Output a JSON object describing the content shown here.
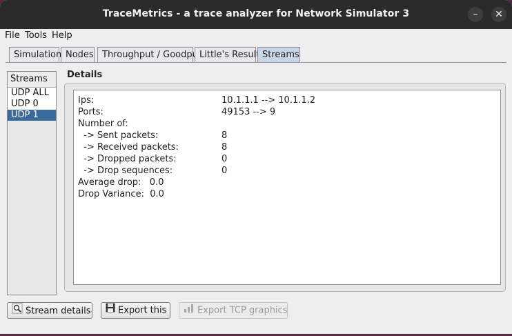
{
  "window": {
    "title": "TraceMetrics - a trace analyzer for Network Simulator 3"
  },
  "menu": [
    "File",
    "Tools",
    "Help"
  ],
  "tabs": [
    "Simulation",
    "Nodes",
    "Throughput / Goodput",
    "Little's Result",
    "Streams"
  ],
  "active_tab": "Streams",
  "streams": {
    "header": "Streams",
    "items": [
      "UDP ALL",
      "UDP 0",
      "UDP 1"
    ],
    "selected": "UDP 1"
  },
  "details": {
    "heading": "Details",
    "rows": [
      {
        "label": "Ips:",
        "value": "10.1.1.1 --> 10.1.1.2"
      },
      {
        "label": "Ports:",
        "value": "49153 --> 9"
      },
      {
        "label": "Number of:",
        "value": ""
      },
      {
        "label": "  -> Sent packets:",
        "value": "8"
      },
      {
        "label": "  -> Received packets:",
        "value": "8"
      },
      {
        "label": "  -> Dropped packets:",
        "value": "0"
      },
      {
        "label": "  -> Drop sequences:",
        "value": "0"
      },
      {
        "label": "Average drop:   0.0",
        "value": ""
      },
      {
        "label": "Drop Variance:  0.0",
        "value": ""
      }
    ]
  },
  "buttons": {
    "stream_details": "Stream details",
    "export_this": "Export this",
    "export_tcp": "Export TCP graphics"
  },
  "colors": {
    "selection": "#3c6a9a",
    "active_tab": "#c8d6e6",
    "titlebar": "#2b2b2b"
  }
}
